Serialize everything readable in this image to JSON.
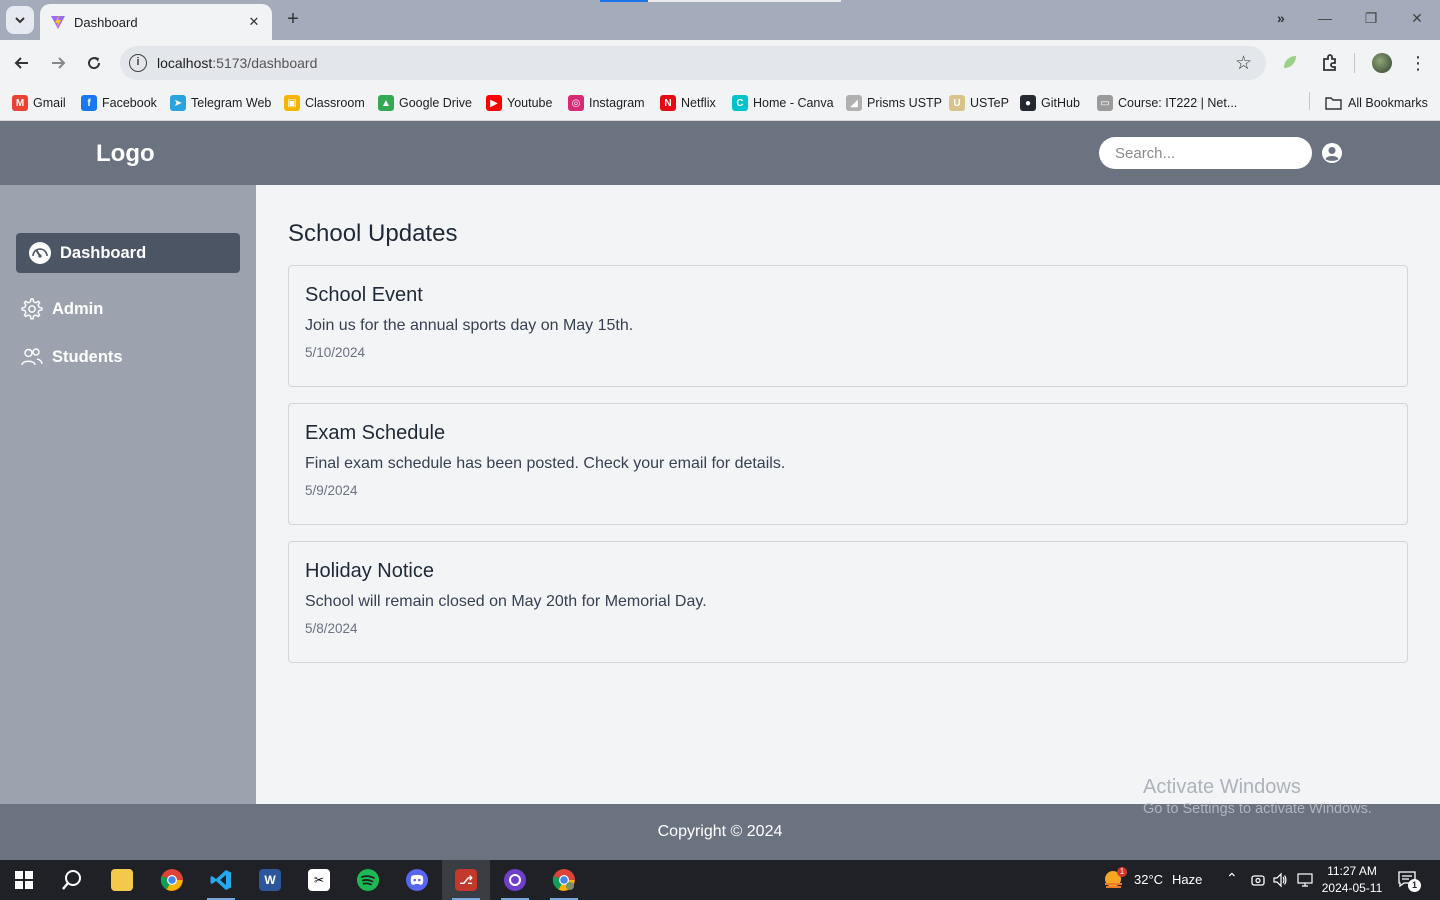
{
  "browser": {
    "tab_title": "Dashboard",
    "new_tab_symbol": "+",
    "url_host": "localhost",
    "url_path": ":5173/dashboard",
    "bookmarks": [
      {
        "label": "Gmail",
        "icon": "gmail-icon",
        "color": "#ea4335",
        "glyph": "M"
      },
      {
        "label": "Facebook",
        "icon": "facebook-icon",
        "color": "#1877f2",
        "glyph": "f"
      },
      {
        "label": "Telegram Web",
        "icon": "telegram-icon",
        "color": "#2aa3df",
        "glyph": "➤"
      },
      {
        "label": "Classroom",
        "icon": "classroom-icon",
        "color": "#f4b400",
        "glyph": "▣"
      },
      {
        "label": "Google Drive",
        "icon": "drive-icon",
        "color": "#34a853",
        "glyph": "▲"
      },
      {
        "label": "Youtube",
        "icon": "youtube-icon",
        "color": "#ff0000",
        "glyph": "▶"
      },
      {
        "label": "Instagram",
        "icon": "instagram-icon",
        "color": "#d62976",
        "glyph": "◎"
      },
      {
        "label": "Netflix",
        "icon": "netflix-icon",
        "color": "#e50914",
        "glyph": "N"
      },
      {
        "label": "Home - Canva",
        "icon": "canva-icon",
        "color": "#00c4cc",
        "glyph": "C"
      },
      {
        "label": "Prisms USTP",
        "icon": "prisms-icon",
        "color": "#b0b0b0",
        "glyph": "◢"
      },
      {
        "label": "USTeP",
        "icon": "ustep-icon",
        "color": "#d8c48a",
        "glyph": "U"
      },
      {
        "label": "GitHub",
        "icon": "github-icon",
        "color": "#24292f",
        "glyph": "●"
      },
      {
        "label": "Course: IT222 | Net...",
        "icon": "course-icon",
        "color": "#9a9a9a",
        "glyph": "▭"
      }
    ],
    "all_bookmarks": "All Bookmarks",
    "more_bookmarks": "»"
  },
  "app": {
    "logo": "Logo",
    "search_placeholder": "Search...",
    "sidebar": [
      {
        "label": "Dashboard",
        "icon": "gauge-icon",
        "active": true
      },
      {
        "label": "Admin",
        "icon": "gear-icon",
        "active": false
      },
      {
        "label": "Students",
        "icon": "users-icon",
        "active": false
      }
    ],
    "page_title": "School Updates",
    "updates": [
      {
        "title": "School Event",
        "body": "Join us for the annual sports day on May 15th.",
        "date": "5/10/2024"
      },
      {
        "title": "Exam Schedule",
        "body": "Final exam schedule has been posted. Check your email for details.",
        "date": "5/9/2024"
      },
      {
        "title": "Holiday Notice",
        "body": "School will remain closed on May 20th for Memorial Day.",
        "date": "5/8/2024"
      }
    ],
    "footer": "Copyright © 2024"
  },
  "watermark": {
    "line1": "Activate Windows",
    "line2": "Go to Settings to activate Windows."
  },
  "taskbar": {
    "weather_temp": "32°C",
    "weather_desc": "Haze",
    "weather_badge": "1",
    "time": "11:27 AM",
    "date": "2024-05-11",
    "notification_count": "1"
  },
  "colors": {
    "header": "#6b7280",
    "sidebar": "#9ca3af",
    "sidebar_active": "#4b5563",
    "main_bg": "#f3f4f6"
  }
}
